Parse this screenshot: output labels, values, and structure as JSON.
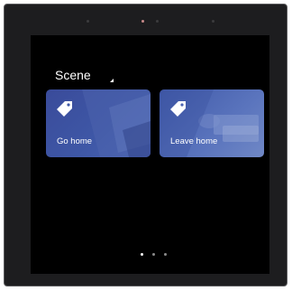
{
  "scene": {
    "title": "Scene",
    "cards": [
      {
        "label": "Go home",
        "icon": "tag-icon"
      },
      {
        "label": "Leave home",
        "icon": "tag-icon"
      }
    ]
  },
  "pagination": {
    "pages": 3,
    "current": 1
  },
  "colors": {
    "screen": "#000000",
    "bezel": "#1d1d1f",
    "card_primary": "#3e57a6",
    "text": "#ffffff"
  }
}
